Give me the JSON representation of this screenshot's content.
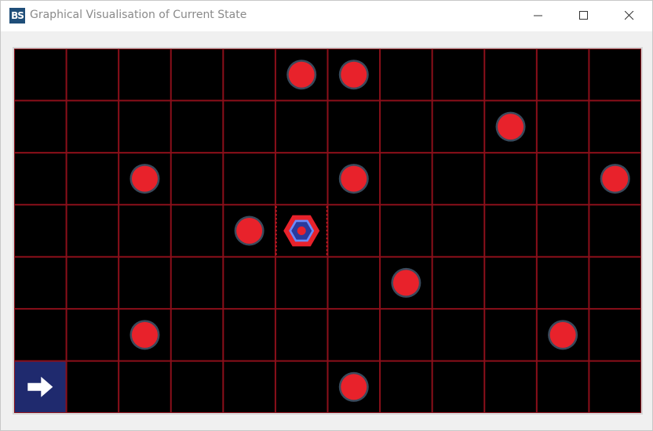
{
  "window": {
    "title": "Graphical Visualisation of Current State",
    "icon_name": "app-logo-icon",
    "icon_text": "BS",
    "controls": [
      "minimize-icon",
      "maximize-icon",
      "close-icon"
    ]
  },
  "board": {
    "cols": 12,
    "rows": 7,
    "background_color": "#000000",
    "grid_color": "#8b0f1a",
    "enemy_color": "#e8222b",
    "enemy_outline_color": "#3a4a5c",
    "agent_outer_color": "#e8222b",
    "agent_ring_color": "#6a8cff",
    "agent_inner_color": "#2a3a9c",
    "agent_core_color": "#e8222b",
    "arrow_tile_color": "#1f2a6e",
    "enemies": [
      {
        "col": 5,
        "row": 0
      },
      {
        "col": 6,
        "row": 0
      },
      {
        "col": 9,
        "row": 1
      },
      {
        "col": 2,
        "row": 2
      },
      {
        "col": 6,
        "row": 2
      },
      {
        "col": 11,
        "row": 2
      },
      {
        "col": 4,
        "row": 3
      },
      {
        "col": 7,
        "row": 4
      },
      {
        "col": 2,
        "row": 5
      },
      {
        "col": 10,
        "row": 5
      },
      {
        "col": 6,
        "row": 6
      }
    ],
    "agent": {
      "col": 5,
      "row": 3
    },
    "arrow_tile": {
      "col": 0,
      "row": 6,
      "direction": "right",
      "icon_name": "arrow-right-icon"
    }
  }
}
